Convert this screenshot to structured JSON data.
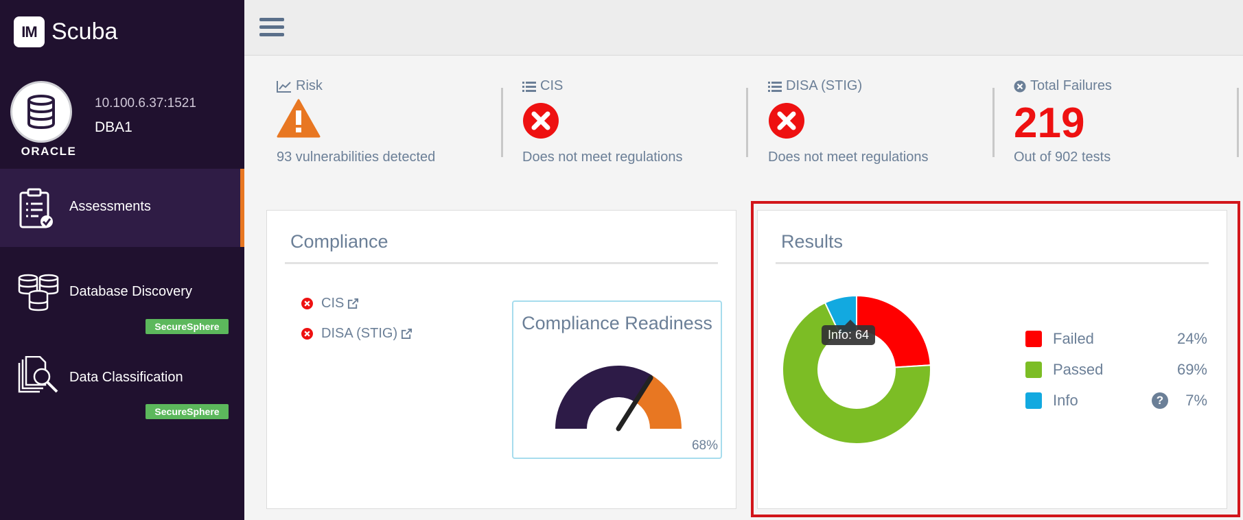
{
  "app": {
    "logo_text": "IM",
    "name": "Scuba"
  },
  "database": {
    "type": "ORACLE",
    "host": "10.100.6.37:1521",
    "name": "DBA1"
  },
  "sidebar": {
    "items": [
      {
        "label": "Assessments",
        "active": true
      },
      {
        "label": "Database Discovery",
        "badge": "SecureSphere"
      },
      {
        "label": "Data Classification",
        "badge": "SecureSphere"
      }
    ]
  },
  "summary": {
    "risk": {
      "title": "Risk",
      "subtitle": "93 vulnerabilities detected",
      "icon": "warning-icon"
    },
    "cis": {
      "title": "CIS",
      "subtitle": "Does not meet regulations",
      "icon": "fail-icon"
    },
    "disa": {
      "title": "DISA (STIG)",
      "subtitle": "Does not meet regulations",
      "icon": "fail-icon"
    },
    "failures": {
      "title": "Total Failures",
      "value": "219",
      "subtitle": "Out of 902 tests"
    }
  },
  "compliance": {
    "title": "Compliance",
    "links": [
      {
        "label": "CIS"
      },
      {
        "label": "DISA (STIG)"
      }
    ],
    "readiness": {
      "title": "Compliance Readiness",
      "value_label": "68%",
      "value": 0.68
    }
  },
  "results": {
    "title": "Results",
    "tooltip": "Info: 64",
    "legend": [
      {
        "label": "Failed",
        "pct": "24%",
        "color": "#ff0000"
      },
      {
        "label": "Passed",
        "pct": "69%",
        "color": "#7cbd25"
      },
      {
        "label": "Info",
        "pct": "7%",
        "color": "#12a9e0",
        "help": "?"
      }
    ]
  },
  "colors": {
    "sidebar": "#20112f",
    "accent": "#e87722",
    "fail": "#ee1111",
    "text": "#6b7f97"
  },
  "chart_data": {
    "type": "pie",
    "categories": [
      "Failed",
      "Passed",
      "Info"
    ],
    "values": [
      24,
      69,
      7
    ],
    "title": "Results"
  }
}
